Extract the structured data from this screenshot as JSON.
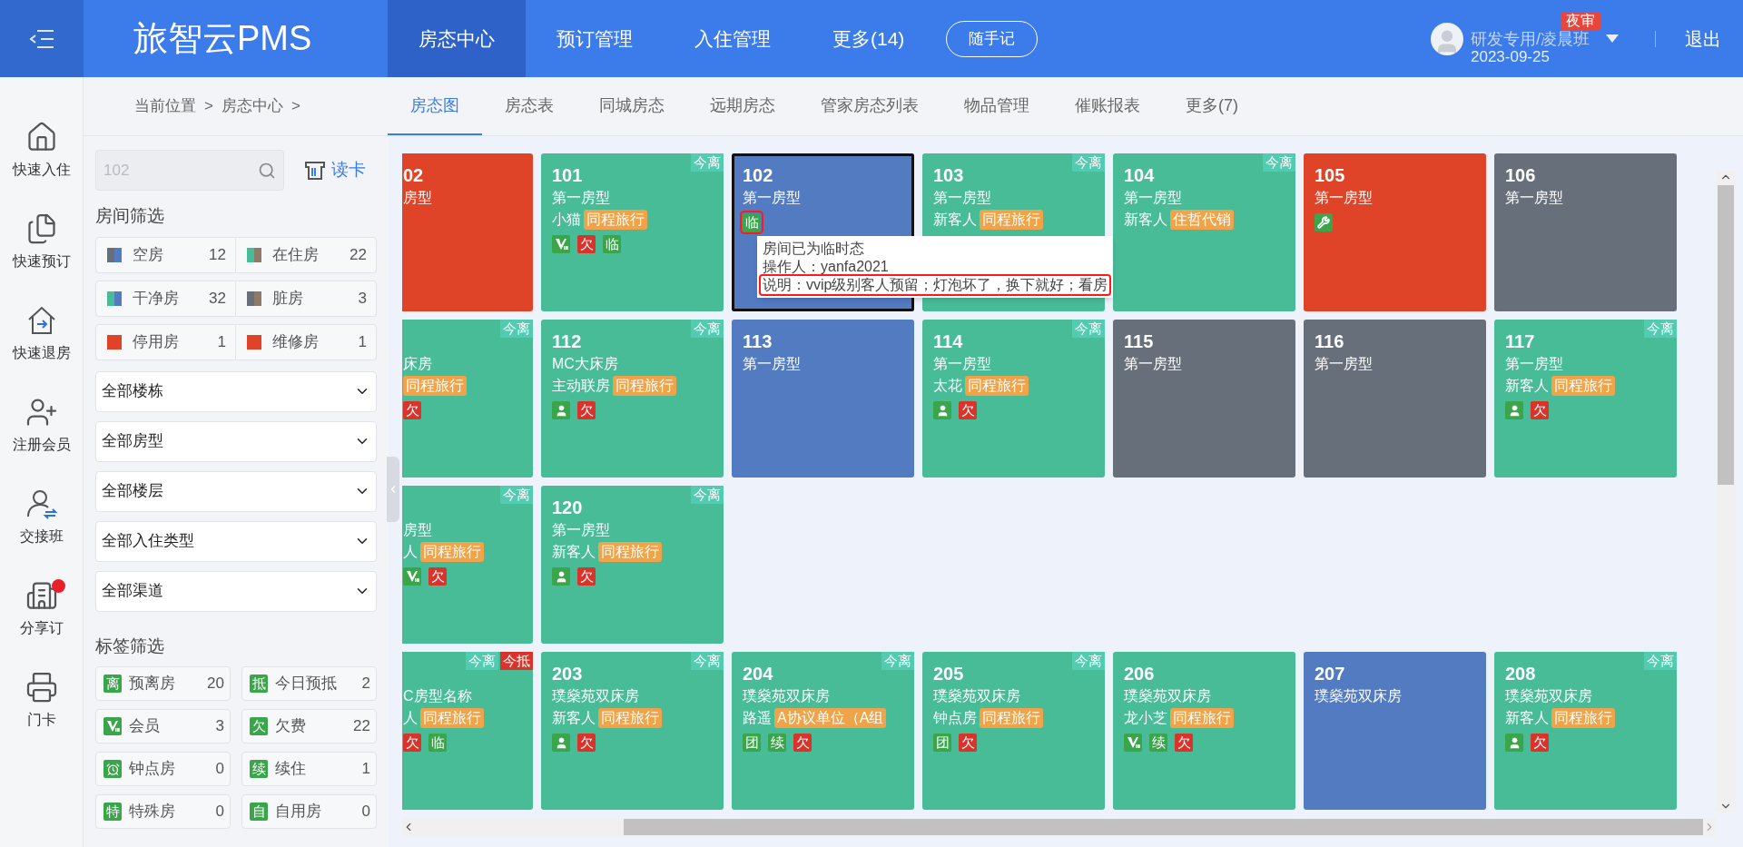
{
  "header": {
    "logo": "旅智云PMS",
    "nav": [
      {
        "label": "房态中心",
        "selected": true
      },
      {
        "label": "预订管理",
        "selected": false
      },
      {
        "label": "入住管理",
        "selected": false
      },
      {
        "label": "更多(14)",
        "selected": false
      }
    ],
    "memo_button": "随手记",
    "user": {
      "name": "研发专用/凌晨班",
      "date": "2023-09-25",
      "badge": "夜审"
    },
    "logout": "退出"
  },
  "side_nav": [
    {
      "label": "快速入住",
      "dot": false
    },
    {
      "label": "快速预订",
      "dot": false
    },
    {
      "label": "快速退房",
      "dot": false
    },
    {
      "label": "注册会员",
      "dot": false
    },
    {
      "label": "交接班",
      "dot": false
    },
    {
      "label": "分享订",
      "dot": true
    },
    {
      "label": "门卡",
      "dot": false
    }
  ],
  "breadcrumb": {
    "items": [
      "当前位置",
      "房态中心"
    ],
    "separator": ">"
  },
  "sub_tabs": [
    {
      "label": "房态图",
      "selected": true
    },
    {
      "label": "房态表",
      "selected": false
    },
    {
      "label": "同城房态",
      "selected": false
    },
    {
      "label": "远期房态",
      "selected": false
    },
    {
      "label": "管家房态列表",
      "selected": false
    },
    {
      "label": "物品管理",
      "selected": false
    },
    {
      "label": "催账报表",
      "selected": false
    },
    {
      "label": "更多(7)",
      "selected": false
    }
  ],
  "filters": {
    "search": {
      "placeholder": "102"
    },
    "read_card": "读卡",
    "room_heading": "房间筛选",
    "room_filters": [
      {
        "label": "空房",
        "count": "12",
        "segments": [
          {
            "color": "#67707a"
          },
          {
            "color": "#527bc2"
          }
        ]
      },
      {
        "label": "在住房",
        "count": "22",
        "segments": [
          {
            "color": "#48bb97"
          },
          {
            "color": "#8d7a68"
          }
        ]
      },
      {
        "label": "干净房",
        "count": "32",
        "segments": [
          {
            "color": "#48bb97"
          },
          {
            "color": "#527bc2"
          }
        ]
      },
      {
        "label": "脏房",
        "count": "3",
        "segments": [
          {
            "color": "#67707a"
          },
          {
            "color": "#8d7a68"
          }
        ]
      },
      {
        "label": "停用房",
        "count": "1",
        "segments": [
          {
            "color": "#e04428"
          }
        ]
      },
      {
        "label": "维修房",
        "count": "1",
        "segments": [
          {
            "color": "#e04428"
          }
        ]
      }
    ],
    "dropdowns": [
      "全部楼栋",
      "全部房型",
      "全部楼层",
      "全部入住类型",
      "全部渠道"
    ],
    "tag_heading": "标签筛选",
    "tag_filters": [
      {
        "kind": "text",
        "icon_text": "离",
        "label": "预离房",
        "count": "20"
      },
      {
        "kind": "text",
        "icon_text": "抵",
        "label": "今日预抵",
        "count": "2"
      },
      {
        "kind": "vip",
        "label": "会员",
        "count": "3"
      },
      {
        "kind": "text",
        "icon_text": "欠",
        "label": "欠费",
        "count": "22"
      },
      {
        "kind": "clock",
        "label": "钟点房",
        "count": "0"
      },
      {
        "kind": "text",
        "icon_text": "续",
        "label": "续住",
        "count": "1"
      },
      {
        "kind": "text",
        "icon_text": "特",
        "label": "特殊房",
        "count": "0"
      },
      {
        "kind": "text",
        "icon_text": "自",
        "label": "自用房",
        "count": "0"
      }
    ]
  },
  "room_rows": [
    [
      {
        "partial": true,
        "number": "02",
        "type": "房型",
        "color": "#e04428",
        "selected": false
      },
      {
        "partial": false,
        "number": "101",
        "type": "第一房型",
        "guest": "小猫",
        "tag": "同程旅行",
        "color": "#48bb97",
        "selected": false,
        "badges": [
          {
            "kind": "vip"
          },
          {
            "kind": "text",
            "text": "欠",
            "color": "#d9342b"
          },
          {
            "kind": "text",
            "text": "临",
            "color": "#3aa54a"
          }
        ],
        "corners": [
          {
            "text": "今离",
            "color": "#52cbb0"
          }
        ]
      },
      {
        "partial": false,
        "number": "102",
        "type": "第一房型",
        "color": "#527bc2",
        "selected": true,
        "badges": [
          {
            "kind": "text",
            "text": "临",
            "color": "#3aa54a",
            "highlighted": true
          }
        ],
        "tooltip": [
          {
            "text": "房间已为临时态",
            "highlighted": false
          },
          {
            "text": "操作人：yanfa2021",
            "highlighted": false
          },
          {
            "text": "说明：vvip级别客人预留；灯泡坏了，换下就好；看房",
            "highlighted": true
          }
        ]
      },
      {
        "partial": false,
        "number": "103",
        "type": "第一房型",
        "guest": "新客人",
        "tag": "同程旅行",
        "color": "#48bb97",
        "selected": false,
        "corners": [
          {
            "text": "今离",
            "color": "#52cbb0"
          }
        ]
      },
      {
        "partial": false,
        "number": "104",
        "type": "第一房型",
        "guest": "新客人",
        "tag": "住哲代销",
        "color": "#48bb97",
        "selected": false,
        "corners": [
          {
            "text": "今离",
            "color": "#52cbb0"
          }
        ]
      },
      {
        "partial": false,
        "number": "105",
        "type": "第一房型",
        "color": "#e04428",
        "selected": false,
        "badges": [
          {
            "kind": "repair"
          }
        ]
      },
      {
        "partial": false,
        "number": "106",
        "type": "第一房型",
        "color": "#67707a",
        "selected": false
      }
    ],
    [
      {
        "partial": true,
        "type": "床房",
        "tag": "同程旅行",
        "color": "#48bb97",
        "selected": false,
        "badges": [
          {
            "kind": "text",
            "text": "欠",
            "color": "#d9342b"
          }
        ],
        "corners": [
          {
            "text": "今离",
            "color": "#52cbb0"
          }
        ]
      },
      {
        "partial": false,
        "number": "112",
        "type": "MC大床房",
        "guest": "主动联房",
        "tag": "同程旅行",
        "color": "#48bb97",
        "selected": false,
        "badges": [
          {
            "kind": "guest"
          },
          {
            "kind": "text",
            "text": "欠",
            "color": "#d9342b"
          }
        ],
        "corners": [
          {
            "text": "今离",
            "color": "#52cbb0"
          }
        ]
      },
      {
        "partial": false,
        "number": "113",
        "type": "第一房型",
        "color": "#527bc2",
        "selected": false
      },
      {
        "partial": false,
        "number": "114",
        "type": "第一房型",
        "guest": "太花",
        "tag": "同程旅行",
        "color": "#48bb97",
        "selected": false,
        "badges": [
          {
            "kind": "guest"
          },
          {
            "kind": "text",
            "text": "欠",
            "color": "#d9342b"
          }
        ],
        "corners": [
          {
            "text": "今离",
            "color": "#52cbb0"
          }
        ]
      },
      {
        "partial": false,
        "number": "115",
        "type": "第一房型",
        "color": "#67707a",
        "selected": false
      },
      {
        "partial": false,
        "number": "116",
        "type": "第一房型",
        "color": "#67707a",
        "selected": false
      },
      {
        "partial": false,
        "number": "117",
        "type": "第一房型",
        "guest": "新客人",
        "tag": "同程旅行",
        "color": "#48bb97",
        "selected": false,
        "badges": [
          {
            "kind": "guest"
          },
          {
            "kind": "text",
            "text": "欠",
            "color": "#d9342b"
          }
        ],
        "corners": [
          {
            "text": "今离",
            "color": "#52cbb0"
          }
        ]
      }
    ],
    [
      {
        "partial": true,
        "type": "房型",
        "guest": "人",
        "tag": "同程旅行",
        "color": "#48bb97",
        "selected": false,
        "badges": [
          {
            "kind": "vip"
          },
          {
            "kind": "text",
            "text": "欠",
            "color": "#d9342b"
          }
        ],
        "corners": [
          {
            "text": "今离",
            "color": "#52cbb0"
          }
        ]
      },
      {
        "partial": false,
        "number": "120",
        "type": "第一房型",
        "guest": "新客人",
        "tag": "同程旅行",
        "color": "#48bb97",
        "selected": false,
        "badges": [
          {
            "kind": "guest"
          },
          {
            "kind": "text",
            "text": "欠",
            "color": "#d9342b"
          }
        ],
        "corners": [
          {
            "text": "今离",
            "color": "#52cbb0"
          }
        ]
      }
    ],
    [
      {
        "partial": true,
        "type": "C房型名称",
        "guest": "人",
        "tag": "同程旅行",
        "color": "#48bb97",
        "selected": false,
        "badges": [
          {
            "kind": "text",
            "text": "欠",
            "color": "#d9342b"
          },
          {
            "kind": "text",
            "text": "临",
            "color": "#3aa54a"
          }
        ],
        "corners": [
          {
            "text": "今离",
            "color": "#52cbb0"
          },
          {
            "text": "今抵",
            "color": "#d9342b"
          }
        ]
      },
      {
        "partial": false,
        "number": "203",
        "type": "璞燊苑双床房",
        "guest": "新客人",
        "tag": "同程旅行",
        "color": "#48bb97",
        "selected": false,
        "badges": [
          {
            "kind": "guest"
          },
          {
            "kind": "text",
            "text": "欠",
            "color": "#d9342b"
          }
        ],
        "corners": [
          {
            "text": "今离",
            "color": "#52cbb0"
          }
        ]
      },
      {
        "partial": false,
        "number": "204",
        "type": "璞燊苑双床房",
        "guest": "路遥",
        "tag": "A协议单位（A组",
        "color": "#48bb97",
        "selected": false,
        "badges": [
          {
            "kind": "text",
            "text": "团",
            "color": "#3aa54a"
          },
          {
            "kind": "text",
            "text": "续",
            "color": "#3aa54a"
          },
          {
            "kind": "text",
            "text": "欠",
            "color": "#d9342b"
          }
        ],
        "corners": [
          {
            "text": "今离",
            "color": "#52cbb0"
          }
        ]
      },
      {
        "partial": false,
        "number": "205",
        "type": "璞燊苑双床房",
        "guest": "钟点房",
        "tag": "同程旅行",
        "color": "#48bb97",
        "selected": false,
        "badges": [
          {
            "kind": "text",
            "text": "团",
            "color": "#3aa54a"
          },
          {
            "kind": "text",
            "text": "欠",
            "color": "#d9342b"
          }
        ],
        "corners": [
          {
            "text": "今离",
            "color": "#52cbb0"
          }
        ]
      },
      {
        "partial": false,
        "number": "206",
        "type": "璞燊苑双床房",
        "guest": "龙小芝",
        "tag": "同程旅行",
        "color": "#48bb97",
        "selected": false,
        "badges": [
          {
            "kind": "vip"
          },
          {
            "kind": "text",
            "text": "续",
            "color": "#3aa54a"
          },
          {
            "kind": "text",
            "text": "欠",
            "color": "#d9342b"
          }
        ]
      },
      {
        "partial": false,
        "number": "207",
        "type": "璞燊苑双床房",
        "color": "#527bc2",
        "selected": false
      },
      {
        "partial": false,
        "number": "208",
        "type": "璞燊苑双床房",
        "guest": "新客人",
        "tag": "同程旅行",
        "color": "#48bb97",
        "selected": false,
        "badges": [
          {
            "kind": "guest"
          },
          {
            "kind": "text",
            "text": "欠",
            "color": "#d9342b"
          }
        ],
        "corners": [
          {
            "text": "今离",
            "color": "#52cbb0"
          }
        ]
      }
    ]
  ]
}
